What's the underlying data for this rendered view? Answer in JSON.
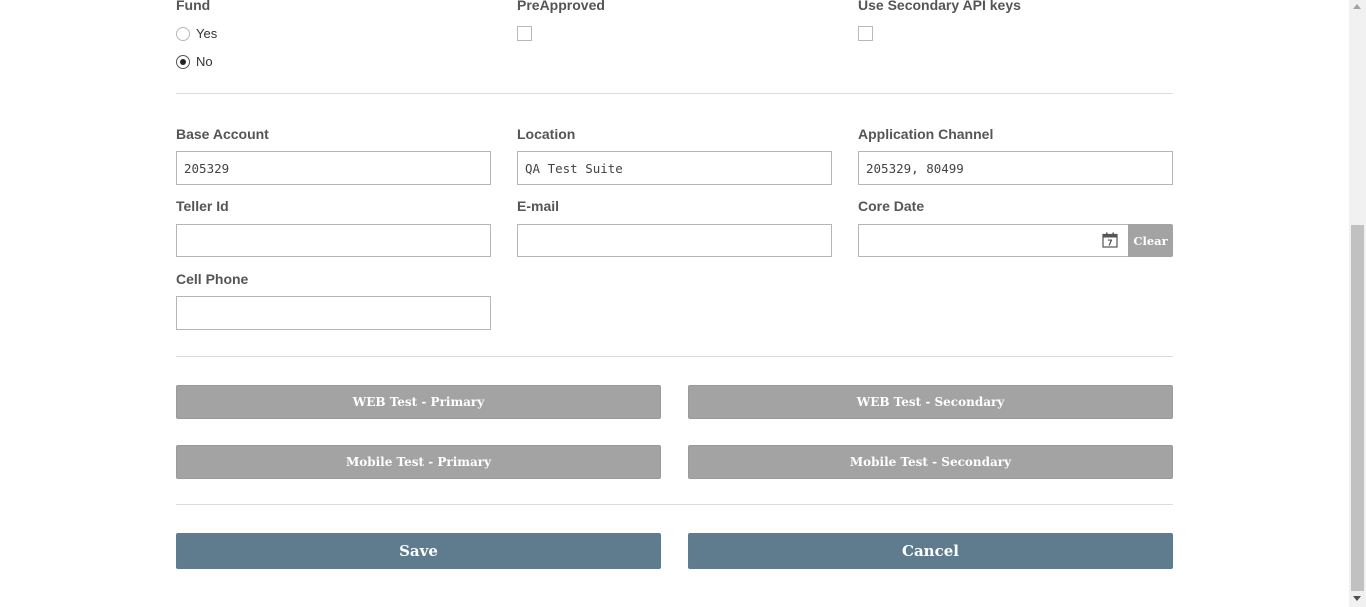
{
  "flags": {
    "fund": {
      "label": "Fund",
      "options": [
        "Yes",
        "No"
      ],
      "selected": "No"
    },
    "preapproved": {
      "label": "PreApproved",
      "checked": false
    },
    "secondary_api": {
      "label": "Use Secondary API keys",
      "checked": false
    }
  },
  "fields": {
    "base_account": {
      "label": "Base Account",
      "value": "205329"
    },
    "location": {
      "label": "Location",
      "value": "QA Test Suite"
    },
    "application_channel": {
      "label": "Application Channel",
      "value": "205329, 80499"
    },
    "teller_id": {
      "label": "Teller Id",
      "value": ""
    },
    "email": {
      "label": "E-mail",
      "value": ""
    },
    "core_date": {
      "label": "Core Date",
      "value": "",
      "clear_label": "Clear",
      "icon": "calendar-icon",
      "icon_day": "7"
    },
    "cell_phone": {
      "label": "Cell Phone",
      "value": ""
    }
  },
  "tests": {
    "web_primary": "WEB Test - Primary",
    "web_secondary": "WEB Test - Secondary",
    "mobile_primary": "Mobile Test - Primary",
    "mobile_secondary": "Mobile Test - Secondary"
  },
  "actions": {
    "save": "Save",
    "cancel": "Cancel"
  },
  "colors": {
    "accent": "#5e7c8e",
    "test_button": "#a3a3a3"
  }
}
